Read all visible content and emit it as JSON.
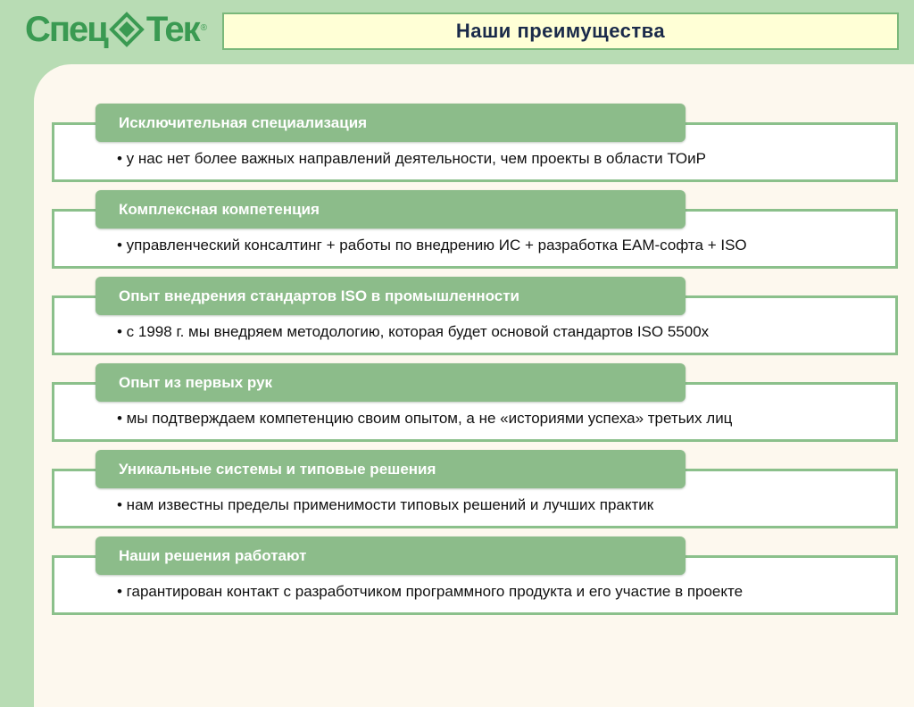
{
  "logo": {
    "text_left": "Спец",
    "text_right": "Тек",
    "registered": "®"
  },
  "title": "Наши преимущества",
  "items": [
    {
      "heading": "Исключительная специализация",
      "text": "• у нас нет более важных направлений деятельности, чем проекты в области ТОиР"
    },
    {
      "heading": "Комплексная компетенция",
      "text": "• управленческий консалтинг + работы по внедрению ИС + разработка EAM-софта + ISO"
    },
    {
      "heading": "Опыт внедрения стандартов ISO в промышленности",
      "text": "• с 1998 г. мы внедряем методологию, которая будет основой стандартов  ISO 5500х"
    },
    {
      "heading": "Опыт из первых рук",
      "text": "• мы подтверждаем компетенцию своим опытом, а не «историями успеха» третьих лиц"
    },
    {
      "heading": "Уникальные системы и типовые решения",
      "text": "• нам известны пределы применимости типовых решений и лучших практик"
    },
    {
      "heading": "Наши решения работают",
      "text": "• гарантирован контакт с разработчиком программного продукта и его участие в проекте"
    }
  ]
}
